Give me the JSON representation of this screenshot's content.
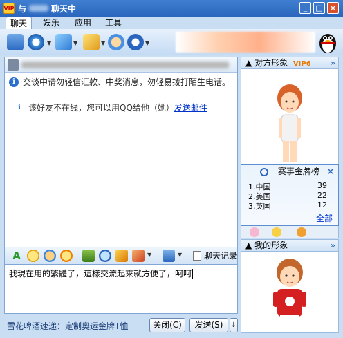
{
  "window": {
    "title_prefix": "与",
    "title_suffix": "聊天中",
    "min_label": "_",
    "max_label": "□",
    "close_label": "×"
  },
  "menu": [
    "聊天",
    "娱乐",
    "应用",
    "工具"
  ],
  "chat": {
    "warning": "交谈中请勿轻信汇款、中奖消息，勿轻易拨打陌生电话。",
    "offline_notice": "该好友不在线，您可以用QQ给他（她）",
    "send_mail_link": "发送邮件"
  },
  "format_bar": {
    "history_label": "聊天记录"
  },
  "input": {
    "value": "我現在用的繁體了，這樣交流起來就方便了，呵呵"
  },
  "bottom": {
    "ad_text": "雪花啤酒速递：定制奥运金牌T恤",
    "close_button": "关闭(C)",
    "send_button": "发送(S)",
    "send_arrow": "↓"
  },
  "right": {
    "other_image_title": "对方形象",
    "vip_label": "VIP6",
    "my_image_title": "我的形象",
    "medal_title": "赛事金牌榜",
    "medal_rows": [
      {
        "rank": "1.",
        "country": "中国",
        "count": "39"
      },
      {
        "rank": "2.",
        "country": "美国",
        "count": "22"
      },
      {
        "rank": "3.",
        "country": "英国",
        "count": "12"
      }
    ],
    "all_link": "全部"
  },
  "colors": {
    "accent": "#2a66bd",
    "link": "#0033cc",
    "vip": "#e87800"
  }
}
